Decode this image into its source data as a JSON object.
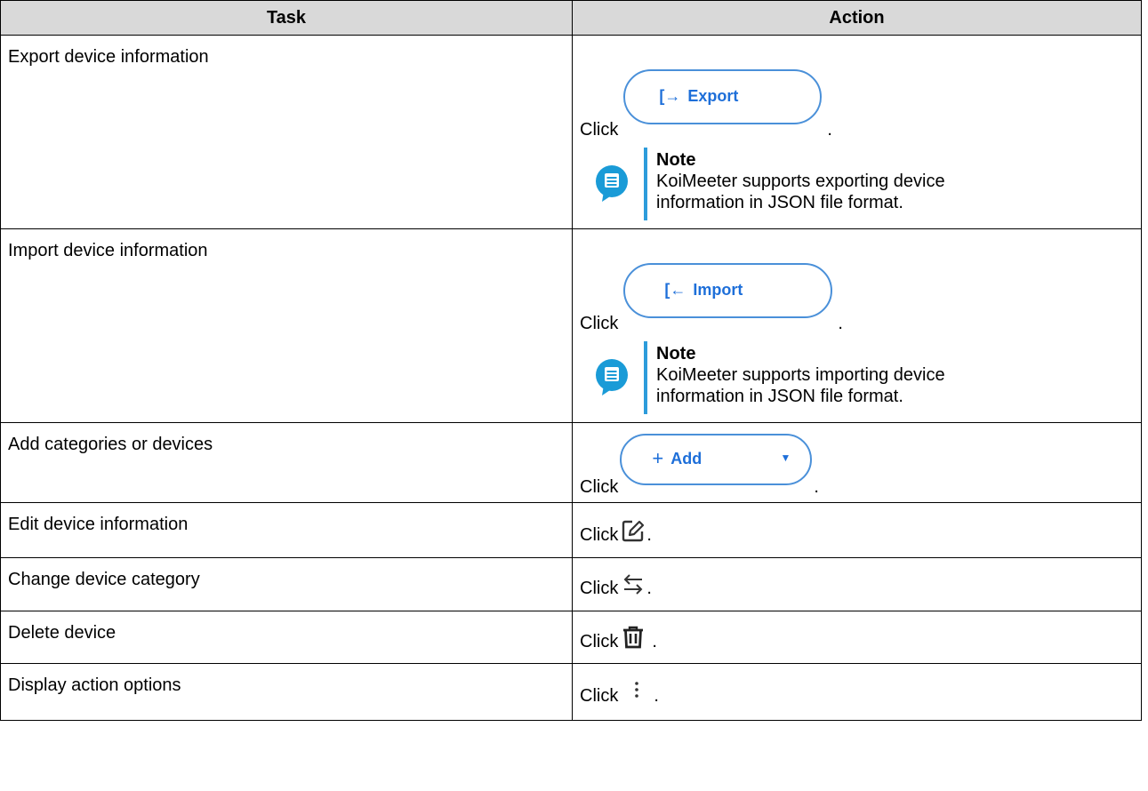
{
  "header": {
    "task": "Task",
    "action": "Action"
  },
  "click_word": "Click",
  "period": ".",
  "rows": [
    {
      "task": "Export device information",
      "button": {
        "glyph": "[→",
        "label": "Export"
      },
      "note": {
        "title": "Note",
        "text": "KoiMeeter supports exporting device information in JSON file format."
      }
    },
    {
      "task": "Import device information",
      "button": {
        "glyph": "[←",
        "label": "Import"
      },
      "note": {
        "title": "Note",
        "text": "KoiMeeter supports importing device information in JSON file format."
      }
    },
    {
      "task": "Add categories or devices",
      "button": {
        "glyph": "+",
        "label": "Add",
        "caret": "▼"
      }
    },
    {
      "task": "Edit device information",
      "icon": "edit-icon"
    },
    {
      "task": "Change device category",
      "icon": "swap-icon"
    },
    {
      "task": "Delete device",
      "icon": "trash-icon"
    },
    {
      "task": "Display action options",
      "icon": "more-vertical-icon"
    }
  ],
  "colors": {
    "accent": "#1e6fd9",
    "pill_border": "#4a90d9",
    "note_bar": "#2d9cdb",
    "note_icon": "#1a9bd7",
    "header_bg": "#d9d9d9"
  }
}
